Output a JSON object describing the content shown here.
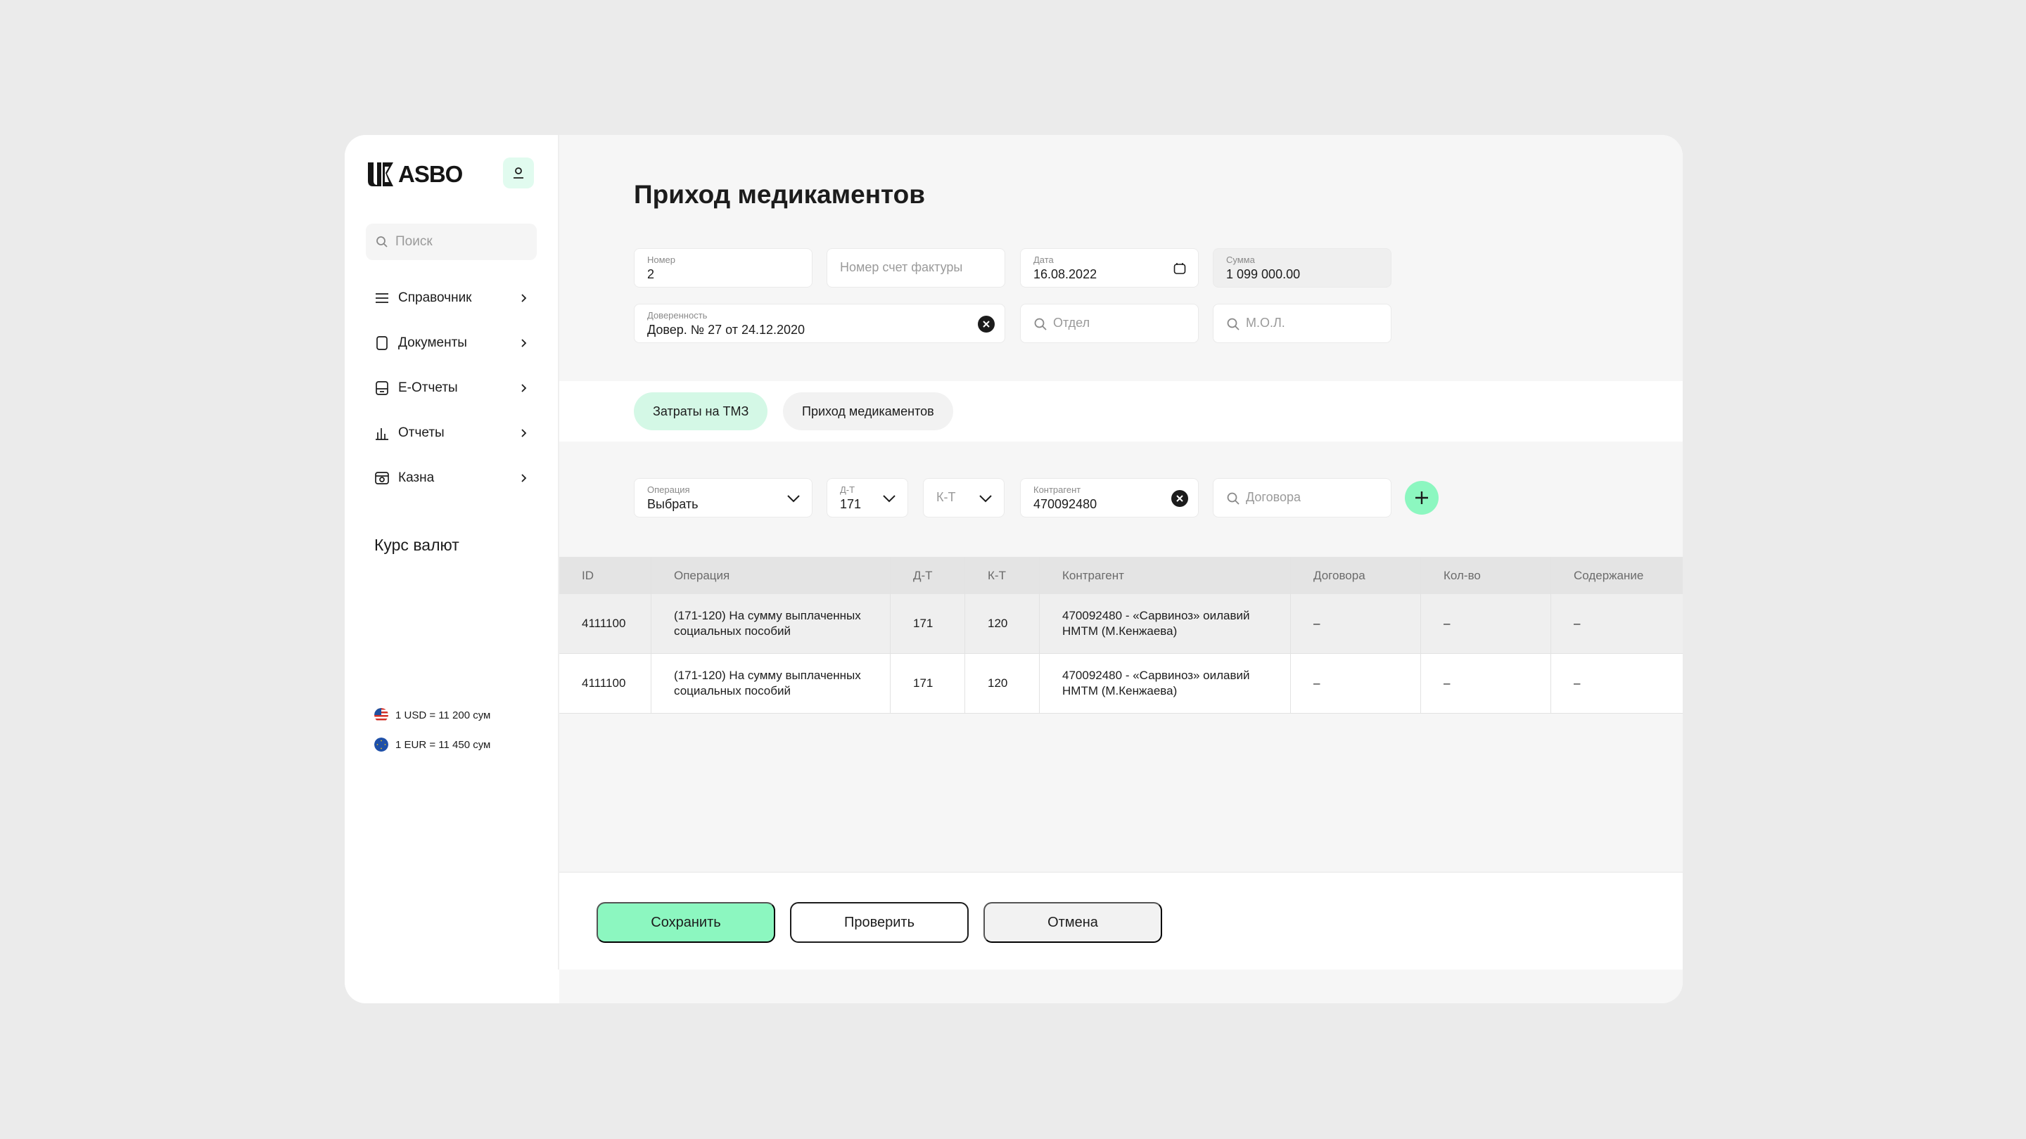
{
  "colors": {
    "accent": "#8cf7c0",
    "accent_light": "#d4f8e6",
    "page_bg": "#ebebeb",
    "main_bg": "#f6f6f6",
    "text": "#1c1c1c"
  },
  "sidebar": {
    "logo_text": "ASBO",
    "search_placeholder": "Поиск",
    "items": [
      {
        "label": "Справочник",
        "icon": "menu-icon"
      },
      {
        "label": "Документы",
        "icon": "document-icon"
      },
      {
        "label": "E-Отчеты",
        "icon": "e-report-icon"
      },
      {
        "label": "Отчеты",
        "icon": "bar-chart-icon"
      },
      {
        "label": "Казна",
        "icon": "treasury-icon"
      }
    ],
    "rates_title": "Курс валют",
    "rates": [
      {
        "text": "1 USD = 11 200 сум",
        "flag": "us-flag-icon"
      },
      {
        "text": "1 EUR = 11 450 сум",
        "flag": "eu-flag-icon"
      }
    ]
  },
  "main": {
    "title": "Приход медикаментов",
    "form": {
      "number": {
        "label": "Номер",
        "value": "2"
      },
      "invoice": {
        "placeholder": "Номер счет фактуры"
      },
      "date": {
        "label": "Дата",
        "value": "16.08.2022"
      },
      "sum": {
        "label": "Сумма",
        "value": "1 099 000.00"
      },
      "power_of_attorney": {
        "label": "Доверенность",
        "value": "Довер. № 27 от 24.12.2020"
      },
      "department": {
        "placeholder": "Отдел"
      },
      "mol": {
        "placeholder": "М.О.Л."
      }
    },
    "tabs": [
      {
        "label": "Затраты на ТМЗ",
        "active": true
      },
      {
        "label": "Приход медикаментов",
        "active": false
      }
    ],
    "filters": {
      "operation": {
        "label": "Операция",
        "value": "Выбрать"
      },
      "dt": {
        "label": "Д-Т",
        "value": "171"
      },
      "kt": {
        "placeholder": "К-Т"
      },
      "counterparty": {
        "label": "Контрагент",
        "value": "470092480"
      },
      "contract": {
        "placeholder": "Договора"
      }
    },
    "table": {
      "columns": [
        "ID",
        "Операция",
        "Д-Т",
        "К-Т",
        "Контрагент",
        "Договора",
        "Кол-во",
        "Содержание"
      ],
      "rows": [
        [
          "4111100",
          "(171-120) На сумму выплаченных социальных пособий",
          "171",
          "120",
          "470092480 - «Сарвиноз» оилавий НМТМ (М.Кенжаева)",
          "–",
          "–",
          "–"
        ],
        [
          "4111100",
          "(171-120) На сумму выплаченных социальных пособий",
          "171",
          "120",
          "470092480 - «Сарвиноз» оилавий НМТМ (М.Кенжаева)",
          "–",
          "–",
          "–"
        ]
      ]
    },
    "buttons": {
      "save": "Сохранить",
      "check": "Проверить",
      "cancel": "Отмена"
    }
  }
}
